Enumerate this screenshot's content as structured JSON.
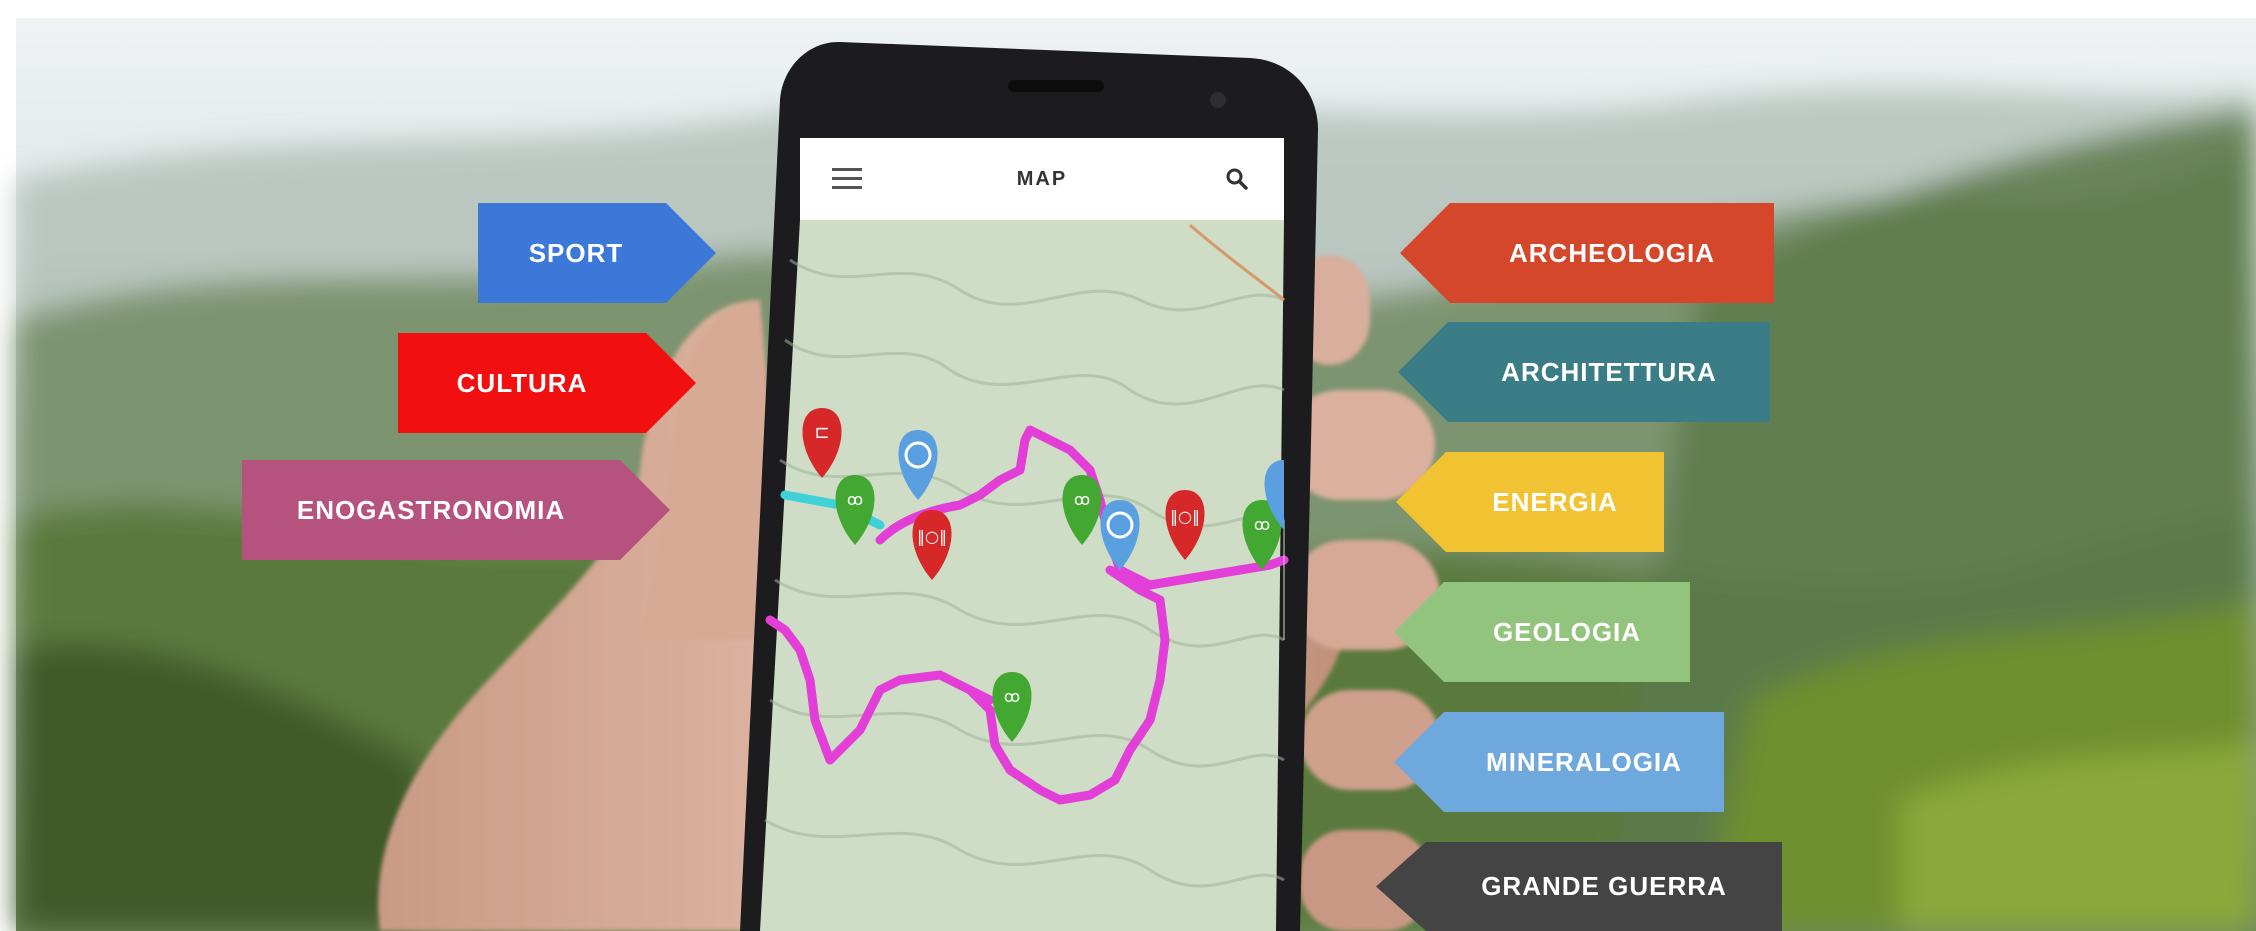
{
  "app": {
    "header_title": "MAP",
    "menu_icon": "hamburger-menu-icon",
    "search_icon": "search-icon"
  },
  "categories_left": [
    {
      "label": "SPORT",
      "color": "#3b78d8"
    },
    {
      "label": "CULTURA",
      "color": "#f20f0f"
    },
    {
      "label": "ENOGASTRONOMIA",
      "color": "#b5527e"
    }
  ],
  "categories_right": [
    {
      "label": "ARCHEOLOGIA",
      "color": "#d4472b"
    },
    {
      "label": "ARCHITETTURA",
      "color": "#3a7d87"
    },
    {
      "label": "ENERGIA",
      "color": "#f1c232"
    },
    {
      "label": "GEOLOGIA",
      "color": "#93c47d"
    },
    {
      "label": "MINERALOGIA",
      "color": "#6fa8dc"
    },
    {
      "label": "GRANDE GUERRA",
      "color": "#444444"
    }
  ],
  "map_markers": [
    {
      "type": "bed-icon",
      "color": "#d62828"
    },
    {
      "type": "bike-icon",
      "color": "#43a832"
    },
    {
      "type": "camera-icon",
      "color": "#5aa0e0"
    },
    {
      "type": "restaurant-icon",
      "color": "#d62828"
    },
    {
      "type": "bike-icon",
      "color": "#43a832"
    },
    {
      "type": "camera-icon",
      "color": "#5aa0e0"
    },
    {
      "type": "restaurant-icon",
      "color": "#d62828"
    },
    {
      "type": "bike-icon",
      "color": "#43a832"
    },
    {
      "type": "camera-icon",
      "color": "#5aa0e0"
    },
    {
      "type": "bike-icon",
      "color": "#43a832"
    }
  ]
}
